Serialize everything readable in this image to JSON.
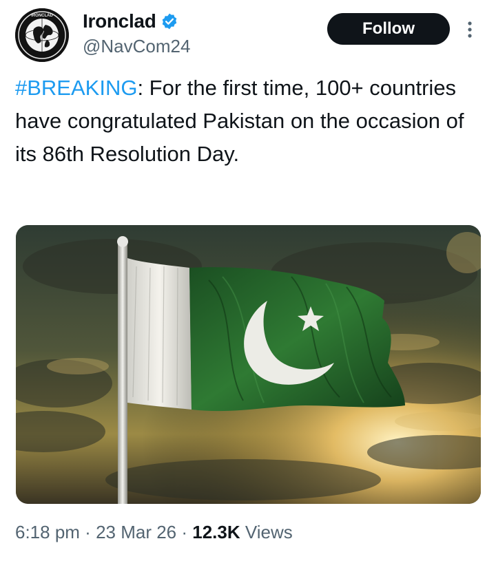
{
  "author": {
    "display_name": "Ironclad",
    "handle": "@NavCom24",
    "verified": true,
    "avatar_icon": "globe-emblem-icon",
    "avatar_text": "IRONCLAD"
  },
  "actions": {
    "follow_label": "Follow",
    "more_icon": "more-vertical-icon"
  },
  "tweet": {
    "hashtag": "#BREAKING",
    "body": ": For the first time, 100+ countries have congratulated Pakistan on the occasion of its 86th Resolution Day."
  },
  "media": {
    "icon": "pakistan-flag-image"
  },
  "meta": {
    "time": "6:18 pm",
    "separator": " · ",
    "date": "23 Mar 26",
    "views_count": "12.3K",
    "views_label": " Views"
  },
  "colors": {
    "accent": "#1d9bf0",
    "text": "#0f1419",
    "secondary_text": "#536471",
    "button_bg": "#0f1419",
    "flag_green": "#1f5a25"
  }
}
